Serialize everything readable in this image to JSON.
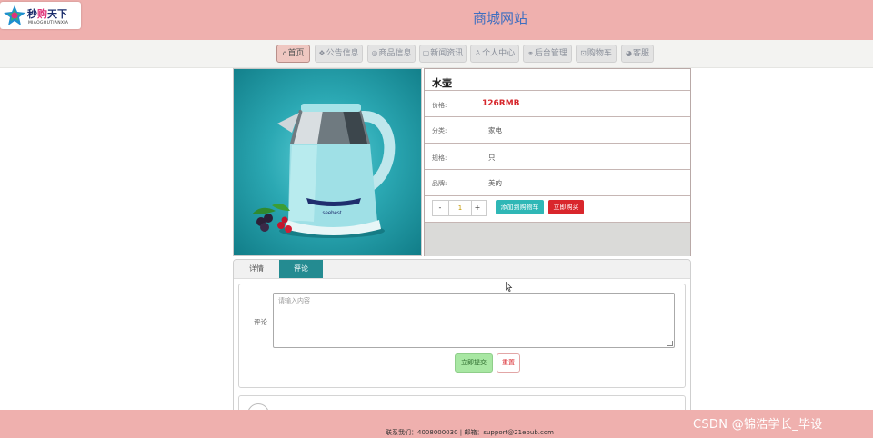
{
  "header": {
    "logo_cn_a": "秒",
    "logo_cn_b": "购",
    "logo_cn_c": "天下",
    "logo_en": "MIAOGOUTIANXIA",
    "site_title": "商城网站"
  },
  "nav": {
    "items": [
      {
        "icon": "⌂",
        "label": "首页"
      },
      {
        "icon": "❖",
        "label": "公告信息"
      },
      {
        "icon": "◎",
        "label": "商品信息"
      },
      {
        "icon": "▢",
        "label": "新闻资讯"
      },
      {
        "icon": "♙",
        "label": "个人中心"
      },
      {
        "icon": "⚭",
        "label": "后台管理"
      },
      {
        "icon": "⊡",
        "label": "购物车"
      },
      {
        "icon": "◕",
        "label": "客服"
      }
    ]
  },
  "product": {
    "name": "水壶",
    "price_label": "价格:",
    "price_value": "126RMB",
    "category_label": "分类:",
    "category_value": "家电",
    "spec_label": "规格:",
    "spec_value": "只",
    "brand_label": "品牌:",
    "brand_value": "美的",
    "qty_minus": "-",
    "qty_value": "1",
    "qty_plus": "+",
    "add_to_cart": "添加到购物车",
    "buy_now": "立即购买",
    "image_brand_text": "seebest"
  },
  "tabs": {
    "details": "详情",
    "comments": "评论"
  },
  "comment_form": {
    "label": "评论",
    "placeholder": "请输入内容",
    "submit": "立即提交",
    "reset": "重置"
  },
  "footer": {
    "contact": "联系我们：4008000030 | 邮箱：support@21epub.com"
  },
  "watermark": "CSDN @锦浩学长_毕设",
  "colors": {
    "header_bg": "#efb0ae",
    "title_blue": "#3f6fc0",
    "price_red": "#d6262b",
    "cart_teal": "#2fb7b6",
    "buy_red": "#d9262c",
    "tab_active": "#248b91",
    "submit_green": "#a8e7a3"
  }
}
